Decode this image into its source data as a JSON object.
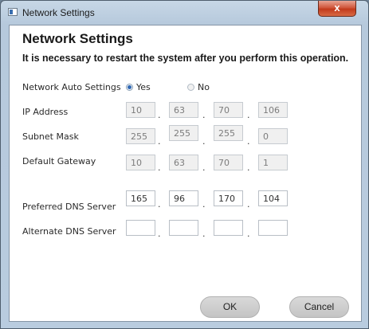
{
  "window": {
    "title": "Network Settings",
    "close_label": "x"
  },
  "dialog": {
    "heading": "Network Settings",
    "notice": "It is necessary to restart the system after you perform this operation."
  },
  "auto_settings": {
    "label": "Network Auto Settings",
    "options": [
      {
        "label": "Yes",
        "selected": true
      },
      {
        "label": "No",
        "selected": false
      }
    ]
  },
  "fields": [
    {
      "label": "IP Address",
      "values": [
        "10",
        "63",
        "70",
        "106"
      ],
      "disabled": true
    },
    {
      "label": "Subnet Mask",
      "values": [
        "255",
        "255",
        "255",
        "0"
      ],
      "disabled": true
    },
    {
      "label": "Default Gateway",
      "values": [
        "10",
        "63",
        "70",
        "1"
      ],
      "disabled": true
    },
    {
      "label": "Preferred DNS Server",
      "values": [
        "165",
        "96",
        "170",
        "104"
      ],
      "disabled": false
    },
    {
      "label": "Alternate DNS Server",
      "values": [
        "",
        "",
        "",
        ""
      ],
      "disabled": false
    }
  ],
  "separator": ".",
  "buttons": {
    "ok": "OK",
    "cancel": "Cancel"
  }
}
